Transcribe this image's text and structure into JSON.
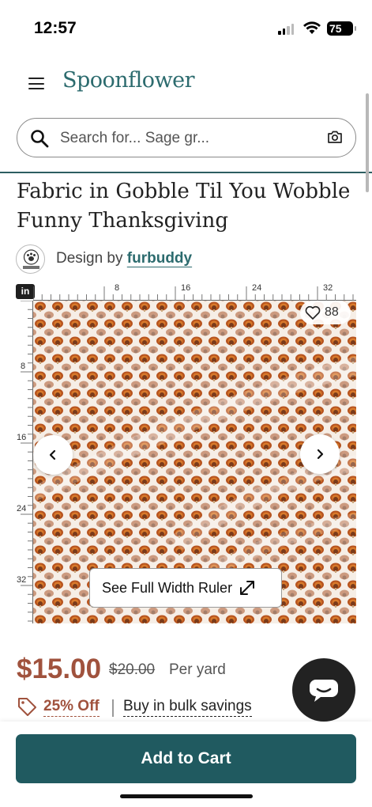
{
  "status_bar": {
    "time": "12:57",
    "battery": "75"
  },
  "header": {
    "logo": "Spoonflower"
  },
  "search": {
    "placeholder": "Search for... Sage gr..."
  },
  "product": {
    "title": "Fabric in Gobble Til You Wobble Funny Thanksgiving",
    "design_by_label": "Design by",
    "designer": "furbuddy",
    "favorites": "88"
  },
  "ruler": {
    "unit": "in",
    "top_ticks": [
      "8",
      "16",
      "24",
      "32"
    ],
    "left_ticks": [
      "8",
      "16",
      "24",
      "32"
    ],
    "full_width_label": "See Full Width Ruler"
  },
  "pricing": {
    "price": "$15.00",
    "old_price": "$20.00",
    "unit": "Per yard",
    "discount": "25% Off",
    "bulk": "Buy in bulk savings"
  },
  "cta": {
    "add_to_cart": "Add to Cart"
  },
  "colors": {
    "brand": "#2c6b6e",
    "price": "#a0523d",
    "cart_button": "#205a60"
  },
  "icons": [
    "menu-icon",
    "search-icon",
    "camera-icon",
    "heart-icon",
    "chevron-left-icon",
    "chevron-right-icon",
    "expand-icon",
    "tag-icon",
    "chat-icon"
  ]
}
